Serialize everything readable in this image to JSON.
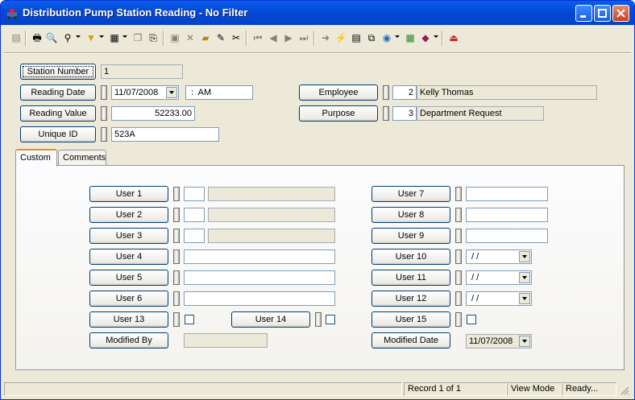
{
  "window": {
    "title": "Distribution Pump Station Reading - No Filter"
  },
  "header": {
    "station_number": {
      "label": "Station Number",
      "value": "1"
    },
    "reading_date": {
      "label": "Reading Date",
      "date": "11/07/2008",
      "time": " :  AM"
    },
    "reading_value": {
      "label": "Reading Value",
      "value": "52233.00"
    },
    "unique_id": {
      "label": "Unique ID",
      "value": "523A"
    },
    "employee": {
      "label": "Employee",
      "id": "2",
      "name": "Kelly Thomas"
    },
    "purpose": {
      "label": "Purpose",
      "id": "3",
      "name": "Department Request"
    }
  },
  "tabs": [
    {
      "label": "Custom",
      "active": true
    },
    {
      "label": "Comments",
      "active": false
    }
  ],
  "custom": {
    "user1": "User 1",
    "user2": "User 2",
    "user3": "User 3",
    "user4": "User 4",
    "user5": "User 5",
    "user6": "User 6",
    "user7": "User 7",
    "user8": "User 8",
    "user9": "User 9",
    "user10": "User 10",
    "user11": "User 11",
    "user12": "User 12",
    "user13": "User 13",
    "user14": "User 14",
    "user15": "User 15",
    "date_placeholder": " / /",
    "modified_by": "Modified By",
    "modified_date": "Modified Date",
    "modified_date_value": "11/07/2008"
  },
  "statusbar": {
    "record": "Record 1 of 1",
    "mode": "View Mode",
    "state": "Ready..."
  },
  "toolbar_icons": [
    "new-icon",
    "print-icon",
    "print-preview-icon",
    "find-icon",
    "filter-icon",
    "form-view-icon",
    "copy-icon",
    "paste-icon",
    "save-icon",
    "delete-icon",
    "attach-icon",
    "edit-icon",
    "cut-icon",
    "first-record-icon",
    "previous-record-icon",
    "next-record-icon",
    "last-record-icon",
    "goto-icon",
    "lightning-icon",
    "report-icon",
    "tree-icon",
    "globe-icon",
    "calculator-icon",
    "book-icon",
    "exit-icon"
  ],
  "colors": {
    "title_bar": "#0548d8",
    "face": "#ece9d8",
    "tab_highlight": "#e68b2c"
  }
}
